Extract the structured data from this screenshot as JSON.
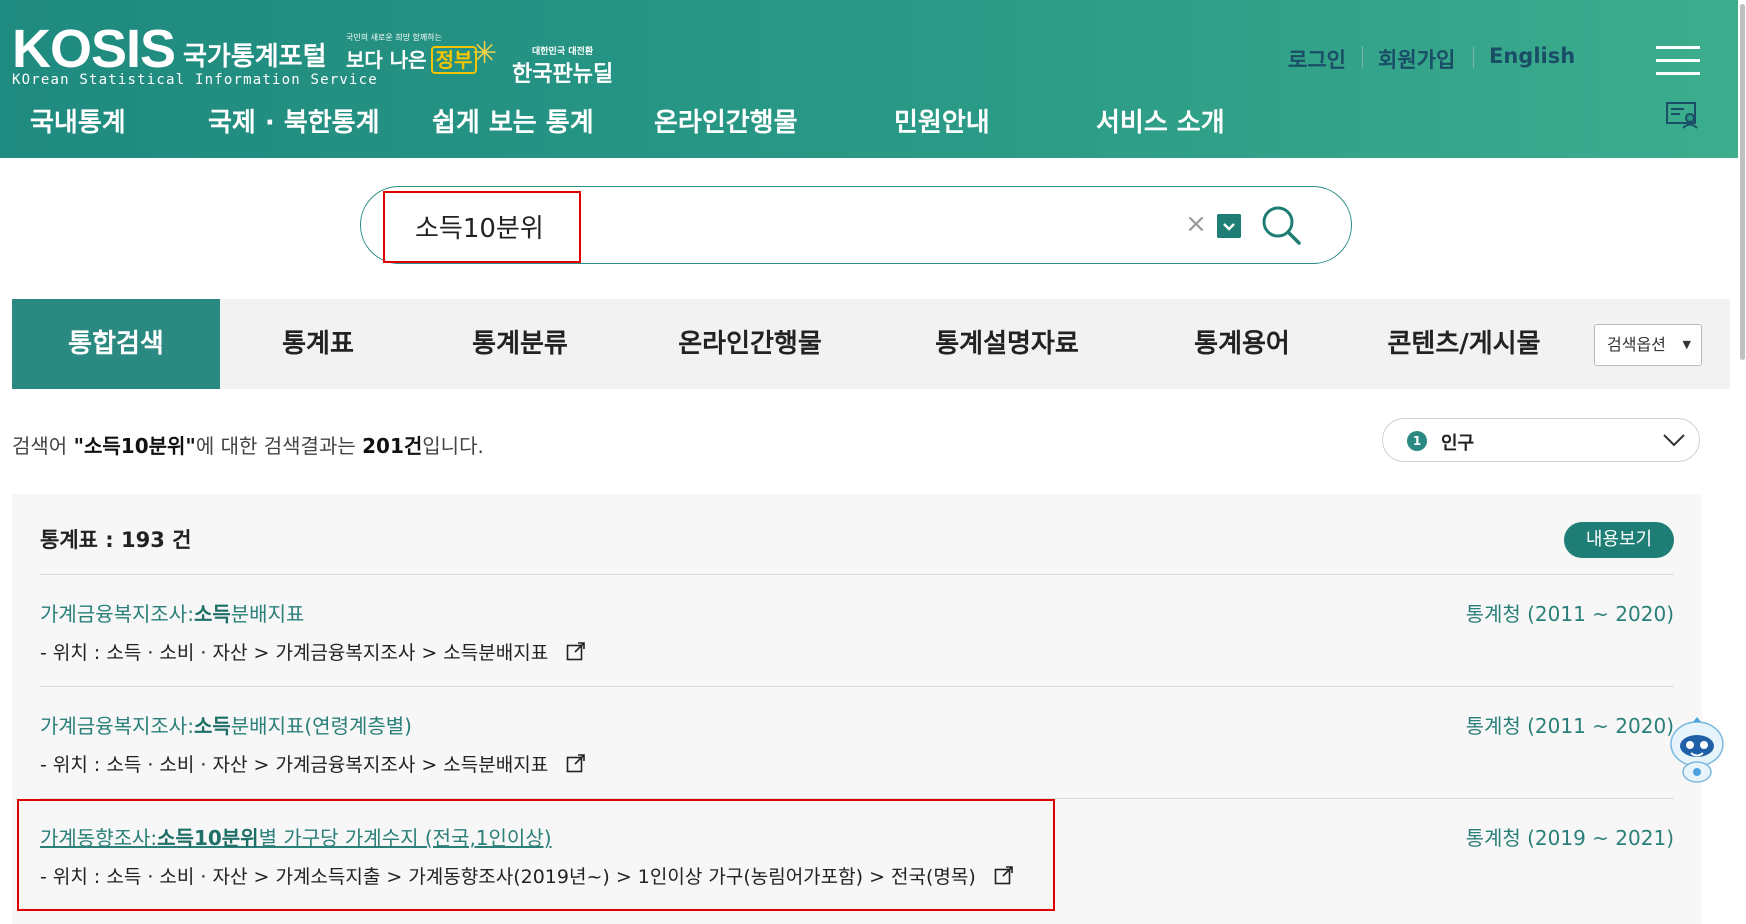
{
  "brand": {
    "logo": "KOSIS",
    "logo_subtitle": "KOrean Statistical Information Service",
    "portal_name": "국가통계포털",
    "campaign1_small": "국민의 새로운 희망 함께하는",
    "campaign1_main": "보다 나은",
    "campaign1_accent": "정부",
    "campaign2_small": "대한민국 대전환",
    "campaign2_main": "한국판뉴딜"
  },
  "util_nav": {
    "login": "로그인",
    "signup": "회원가입",
    "english": "English"
  },
  "gnb": [
    "국내통계",
    "국제 · 북한통계",
    "쉽게 보는 통계",
    "온라인간행물",
    "민원안내",
    "서비스 소개"
  ],
  "search": {
    "query": "소득10분위",
    "clear_label": "×"
  },
  "tabs": [
    "통합검색",
    "통계표",
    "통계분류",
    "온라인간행물",
    "통계설명자료",
    "통계용어",
    "콘텐츠/게시물"
  ],
  "search_options_label": "검색옵션",
  "summary": {
    "prefix": "검색어 ",
    "query_quoted": "\"소득10분위\"",
    "middle": "에 대한 검색결과는 ",
    "count": "201건",
    "suffix": "입니다."
  },
  "category": {
    "number": "1",
    "label": "인구"
  },
  "results_section": {
    "title": "통계표 : 193 건",
    "view_label": "내용보기"
  },
  "results": [
    {
      "title_pre": "가계금융복지조사:",
      "title_hl": "소득",
      "title_post": "분배지표",
      "org": "통계청 (2011 ~ 2020)",
      "path": "- 위치 : 소득 · 소비 · 자산 > 가계금융복지조사 > 소득분배지표"
    },
    {
      "title_pre": "가계금융복지조사:",
      "title_hl": "소득",
      "title_post": "분배지표(연령계층별)",
      "org": "통계청 (2011 ~ 2020)",
      "path": "- 위치 : 소득 · 소비 · 자산 > 가계금융복지조사 > 소득분배지표"
    },
    {
      "title_pre": "가계동향조사:",
      "title_hl": "소득10분위",
      "title_post": "별 가구당 가계수지 (전국,1인이상)",
      "org": "통계청 (2019 ~ 2021)",
      "path": "- 위치 : 소득 · 소비 · 자산 > 가계소득지출 > 가계동향조사(2019년~) > 1인이상 가구(농림어가포함) > 전국(명목)"
    }
  ],
  "colors": {
    "header": "#2a9a86",
    "accent": "#2a8a82",
    "highlight_box": "#e10000"
  }
}
